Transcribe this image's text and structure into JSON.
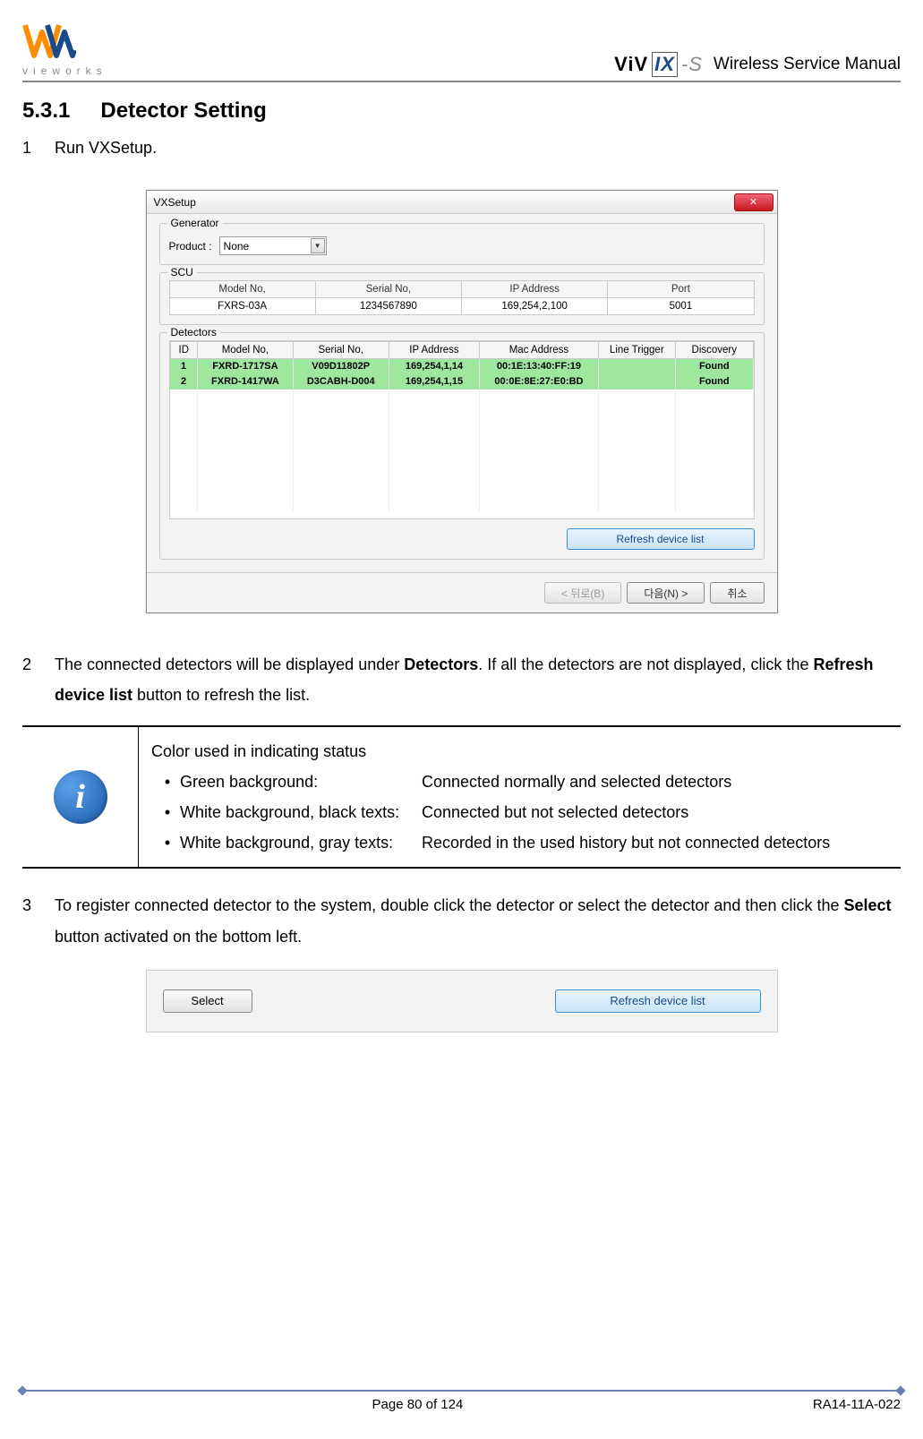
{
  "header": {
    "logo_text": "vieworks",
    "product_logo_a": "ViV",
    "product_logo_b": "IX",
    "product_logo_c": "-S",
    "manual_title": "Wireless Service Manual"
  },
  "section": {
    "num": "5.3.1",
    "title": "Detector Setting"
  },
  "steps": {
    "s1": {
      "num": "1",
      "text": "Run VXSetup."
    },
    "s2": {
      "num": "2",
      "pre": "The connected detectors will be displayed under ",
      "bold1": "Detectors",
      "mid": ". If all the detectors are not displayed, click the ",
      "bold2": "Refresh device list",
      "post": " button to refresh the list."
    },
    "s3": {
      "num": "3",
      "pre": "To register connected detector to the system, double click the detector or select the detector and then click the ",
      "bold1": "Select",
      "post": " button activated on the bottom left."
    }
  },
  "dialog": {
    "title": "VXSetup",
    "generator": {
      "label": "Generator",
      "product_label": "Product :",
      "product_value": "None"
    },
    "scu": {
      "label": "SCU",
      "headers": [
        "Model No,",
        "Serial No,",
        "IP Address",
        "Port"
      ],
      "row": [
        "FXRS-03A",
        "1234567890",
        "169,254,2,100",
        "5001"
      ]
    },
    "detectors": {
      "label": "Detectors",
      "headers": [
        "ID",
        "Model No,",
        "Serial No,",
        "IP Address",
        "Mac Address",
        "Line Trigger",
        "Discovery"
      ],
      "rows": [
        [
          "1",
          "FXRD-1717SA",
          "V09D11802P",
          "169,254,1,14",
          "00:1E:13:40:FF:19",
          "",
          "Found"
        ],
        [
          "2",
          "FXRD-1417WA",
          "D3CABH-D004",
          "169,254,1,15",
          "00:0E:8E:27:E0:BD",
          "",
          "Found"
        ]
      ]
    },
    "refresh": "Refresh device list",
    "back": "< 뒤로(B)",
    "next": "다음(N) >",
    "cancel": "취소"
  },
  "infobox": {
    "title": "Color used in indicating status",
    "items": [
      {
        "lbl": "Green background:",
        "desc": "Connected normally and selected detectors"
      },
      {
        "lbl": "White background, black texts:",
        "desc": "Connected but not selected detectors"
      },
      {
        "lbl": "White background, gray texts:",
        "desc": "Recorded in the used history but not connected detectors"
      }
    ]
  },
  "shot2": {
    "select": "Select",
    "refresh": "Refresh device list"
  },
  "footer": {
    "page": "Page 80 of 124",
    "doc": "RA14-11A-022"
  }
}
